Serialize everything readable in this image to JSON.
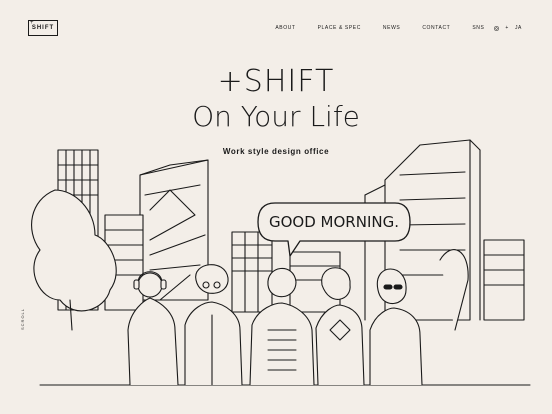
{
  "header": {
    "logo_text": "SHIFT",
    "logo_plus": "+",
    "nav": [
      {
        "label": "ABOUT"
      },
      {
        "label": "PLACE & SPEC"
      },
      {
        "label": "NEWS"
      },
      {
        "label": "CONTACT"
      }
    ],
    "sns_label": "SNS",
    "lang_label": "JA"
  },
  "hero": {
    "title_line1": "+SHIFT",
    "title_line2": "On Your Life",
    "subtitle": "Work style design office"
  },
  "bubble": {
    "text": "GOOD MORNING."
  },
  "side_label": "SCROLL"
}
